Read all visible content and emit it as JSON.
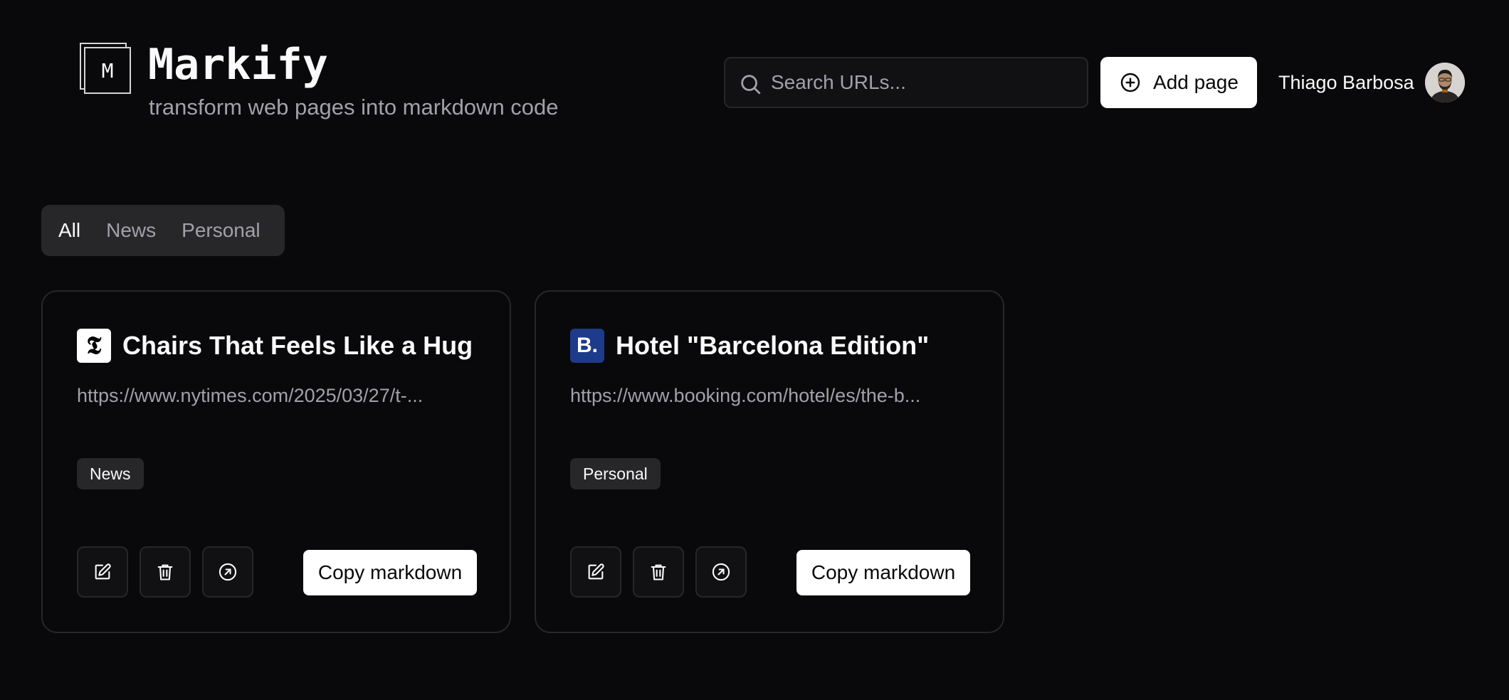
{
  "brand": {
    "logo_letter": "M",
    "title": "Markify",
    "subtitle": "transform web pages into markdown code"
  },
  "search": {
    "placeholder": "Search URLs...",
    "value": "",
    "icon": "search-icon"
  },
  "toolbar": {
    "add_label": "Add page",
    "add_icon": "plus-circle-icon"
  },
  "user": {
    "name": "Thiago Barbosa"
  },
  "tabs": [
    {
      "label": "All",
      "active": true
    },
    {
      "label": "News",
      "active": false
    },
    {
      "label": "Personal",
      "active": false
    }
  ],
  "cards": [
    {
      "favicon_glyph": "𝕿",
      "favicon_bg": "#ffffff",
      "favicon_fg": "#000000",
      "title": "Chairs That Feels Like a Hug",
      "url": "https://www.nytimes.com/2025/03/27/t-...",
      "tag": "News",
      "copy_label": "Copy markdown"
    },
    {
      "favicon_glyph": "B.",
      "favicon_bg": "#1e3a8a",
      "favicon_fg": "#ffffff",
      "title": "Hotel \"Barcelona Edition\"",
      "url": "https://www.booking.com/hotel/es/the-b...",
      "tag": "Personal",
      "copy_label": "Copy markdown"
    }
  ],
  "colors": {
    "background": "#09090b",
    "border": "#27272a",
    "muted_text": "#a1a1aa",
    "button_light": "#ffffff"
  }
}
